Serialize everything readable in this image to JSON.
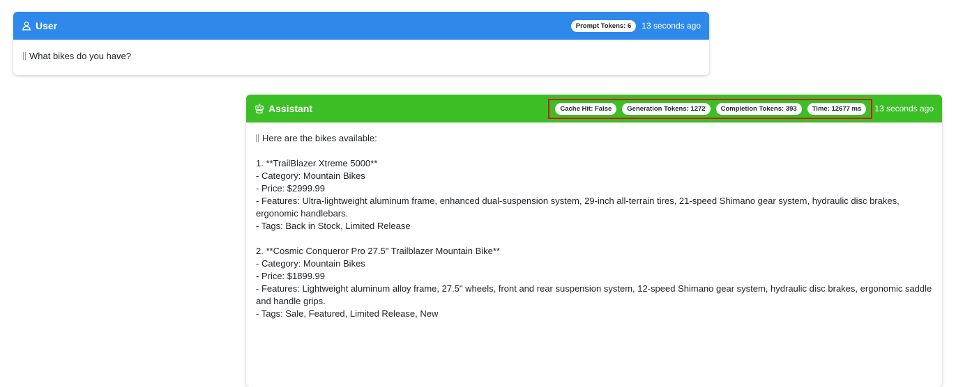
{
  "user_message": {
    "role_label": "User",
    "role_icon": "user-icon",
    "prompt_tokens_badge": "Prompt Tokens: 6",
    "time_ago": "13 seconds ago",
    "text": "What bikes do you have?"
  },
  "assistant_message": {
    "role_label": "Assistant",
    "role_icon": "robot-icon",
    "badges": {
      "cache_hit": "Cache Hit: False",
      "generation_tokens": "Generation Tokens: 1272",
      "completion_tokens": "Completion Tokens: 393",
      "time": "Time: 12677 ms"
    },
    "time_ago": "13 seconds ago",
    "intro": "Here are the bikes available:",
    "items": [
      {
        "title": "1. **TrailBlazer Xtreme 5000**",
        "category": "- Category: Mountain Bikes",
        "price": "- Price: $2999.99",
        "features": "- Features: Ultra-lightweight aluminum frame, enhanced dual-suspension system, 29-inch all-terrain tires, 21-speed Shimano gear system, hydraulic disc brakes, ergonomic handlebars.",
        "tags": "- Tags: Back in Stock, Limited Release"
      },
      {
        "title": "2. **Cosmic Conqueror Pro 27.5\" Trailblazer Mountain Bike**",
        "category": "- Category: Mountain Bikes",
        "price": "- Price: $1899.99",
        "features": "- Features: Lightweight aluminum alloy frame, 27.5\" wheels, front and rear suspension system, 12-speed Shimano gear system, hydraulic disc brakes, ergonomic saddle and handle grips.",
        "tags": "- Tags: Sale, Featured, Limited Release, New"
      }
    ]
  },
  "colors": {
    "user_header": "#2f89ea",
    "assistant_header": "#3cbf25",
    "highlight_border": "#d9141b"
  }
}
